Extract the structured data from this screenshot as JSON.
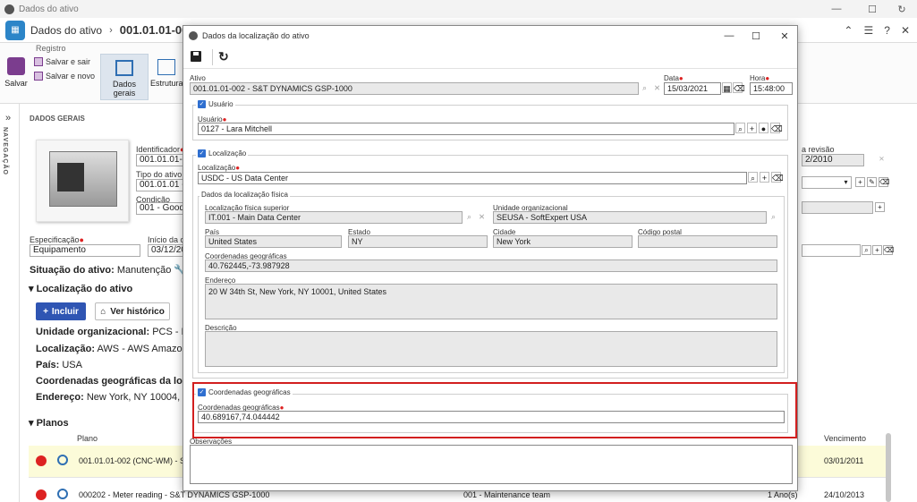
{
  "window": {
    "title": "Dados do ativo"
  },
  "header": {
    "breadcrumb_1": "Dados do ativo",
    "breadcrumb_2": "001.01.01-002 -"
  },
  "ribbon": {
    "group_label": "Registro",
    "save": "Salvar",
    "save_exit": "Salvar e sair",
    "save_new": "Salvar e novo",
    "general_data": "Dados gerais",
    "structure": "Estrutura"
  },
  "nav": {
    "vertical_label": "NAVEGAÇÃO"
  },
  "background": {
    "section_title": "DADOS GERAIS",
    "identifier_label": "Identificador",
    "identifier_value": "001.01.01-0",
    "asset_type_label": "Tipo do ativo",
    "asset_type_value": "001.01.01 -",
    "condition_label": "Condição",
    "condition_value": "001 - Good",
    "revision_date_label": "a revisão",
    "revision_date_value": "2/2010",
    "specification_label": "Especificação",
    "specification_value": "Equipamento",
    "start_label": "Início da op",
    "start_value": "03/12/20",
    "status_label": "Situação do ativo:",
    "status_value": "Manutenção",
    "location_heading": "Localização do ativo",
    "btn_include": "Incluir",
    "btn_history": "Ver histórico",
    "org_unit_label": "Unidade organizacional:",
    "org_unit_value": "PCS - Print",
    "location_label": "Localização:",
    "location_value": "AWS - AWS Amazon Cl",
    "country_label": "País:",
    "country_value": "USA",
    "geo_label": "Coordenadas geográficas da localiz",
    "address_label": "Endereço:",
    "address_value": "New York, NY 10004, US",
    "plans_heading": "Planos",
    "plans_col_plan": "Plano",
    "plans_col_due": "Vencimento",
    "plans": [
      {
        "text": "001.01.01-002 (CNC-WM) - S&T",
        "due": "03/01/2011"
      },
      {
        "text": "000202 - Meter reading - S&T DYNAMICS GSP-1000",
        "team": "001 - Maintenance team",
        "period": "1 Ano(s)",
        "due": "24/10/2013"
      }
    ]
  },
  "modal": {
    "title": "Dados da localização do ativo",
    "asset_label": "Ativo",
    "asset_value": "001.01.01-002 - S&T DYNAMICS GSP-1000",
    "date_label": "Data",
    "date_value": "15/03/2021",
    "time_label": "Hora",
    "time_value": "15:48:00",
    "user_section": "Usuário",
    "user_label": "Usuário",
    "user_value": "0127 - Lara Mitchell",
    "location_section": "Localização",
    "location_label": "Localização",
    "location_value": "USDC - US Data Center",
    "physical_section": "Dados da localização física",
    "parent_label": "Localização física superior",
    "parent_value": "IT.001 - Main Data Center",
    "org_unit_label": "Unidade organizacional",
    "org_unit_value": "SEUSA - SoftExpert USA",
    "country_label": "País",
    "country_value": "United States",
    "state_label": "Estado",
    "state_value": "NY",
    "city_label": "Cidade",
    "city_value": "New York",
    "zip_label": "Código postal",
    "zip_value": "",
    "phys_geo_label": "Coordenadas geográficas",
    "phys_geo_value": "40.762445,-73.987928",
    "address_label": "Endereço",
    "address_value": "20 W 34th St, New York, NY 10001, United States",
    "description_label": "Descrição",
    "description_value": "",
    "geo_section": "Coordenadas geográficas",
    "geo_label": "Coordenadas geográficas",
    "geo_value": "40.689167,74.044442",
    "notes_label": "Observações",
    "notes_value": ""
  },
  "colors": {
    "accent": "#2f55b3",
    "highlight": "#d21f1f",
    "required": "#dd2222"
  }
}
